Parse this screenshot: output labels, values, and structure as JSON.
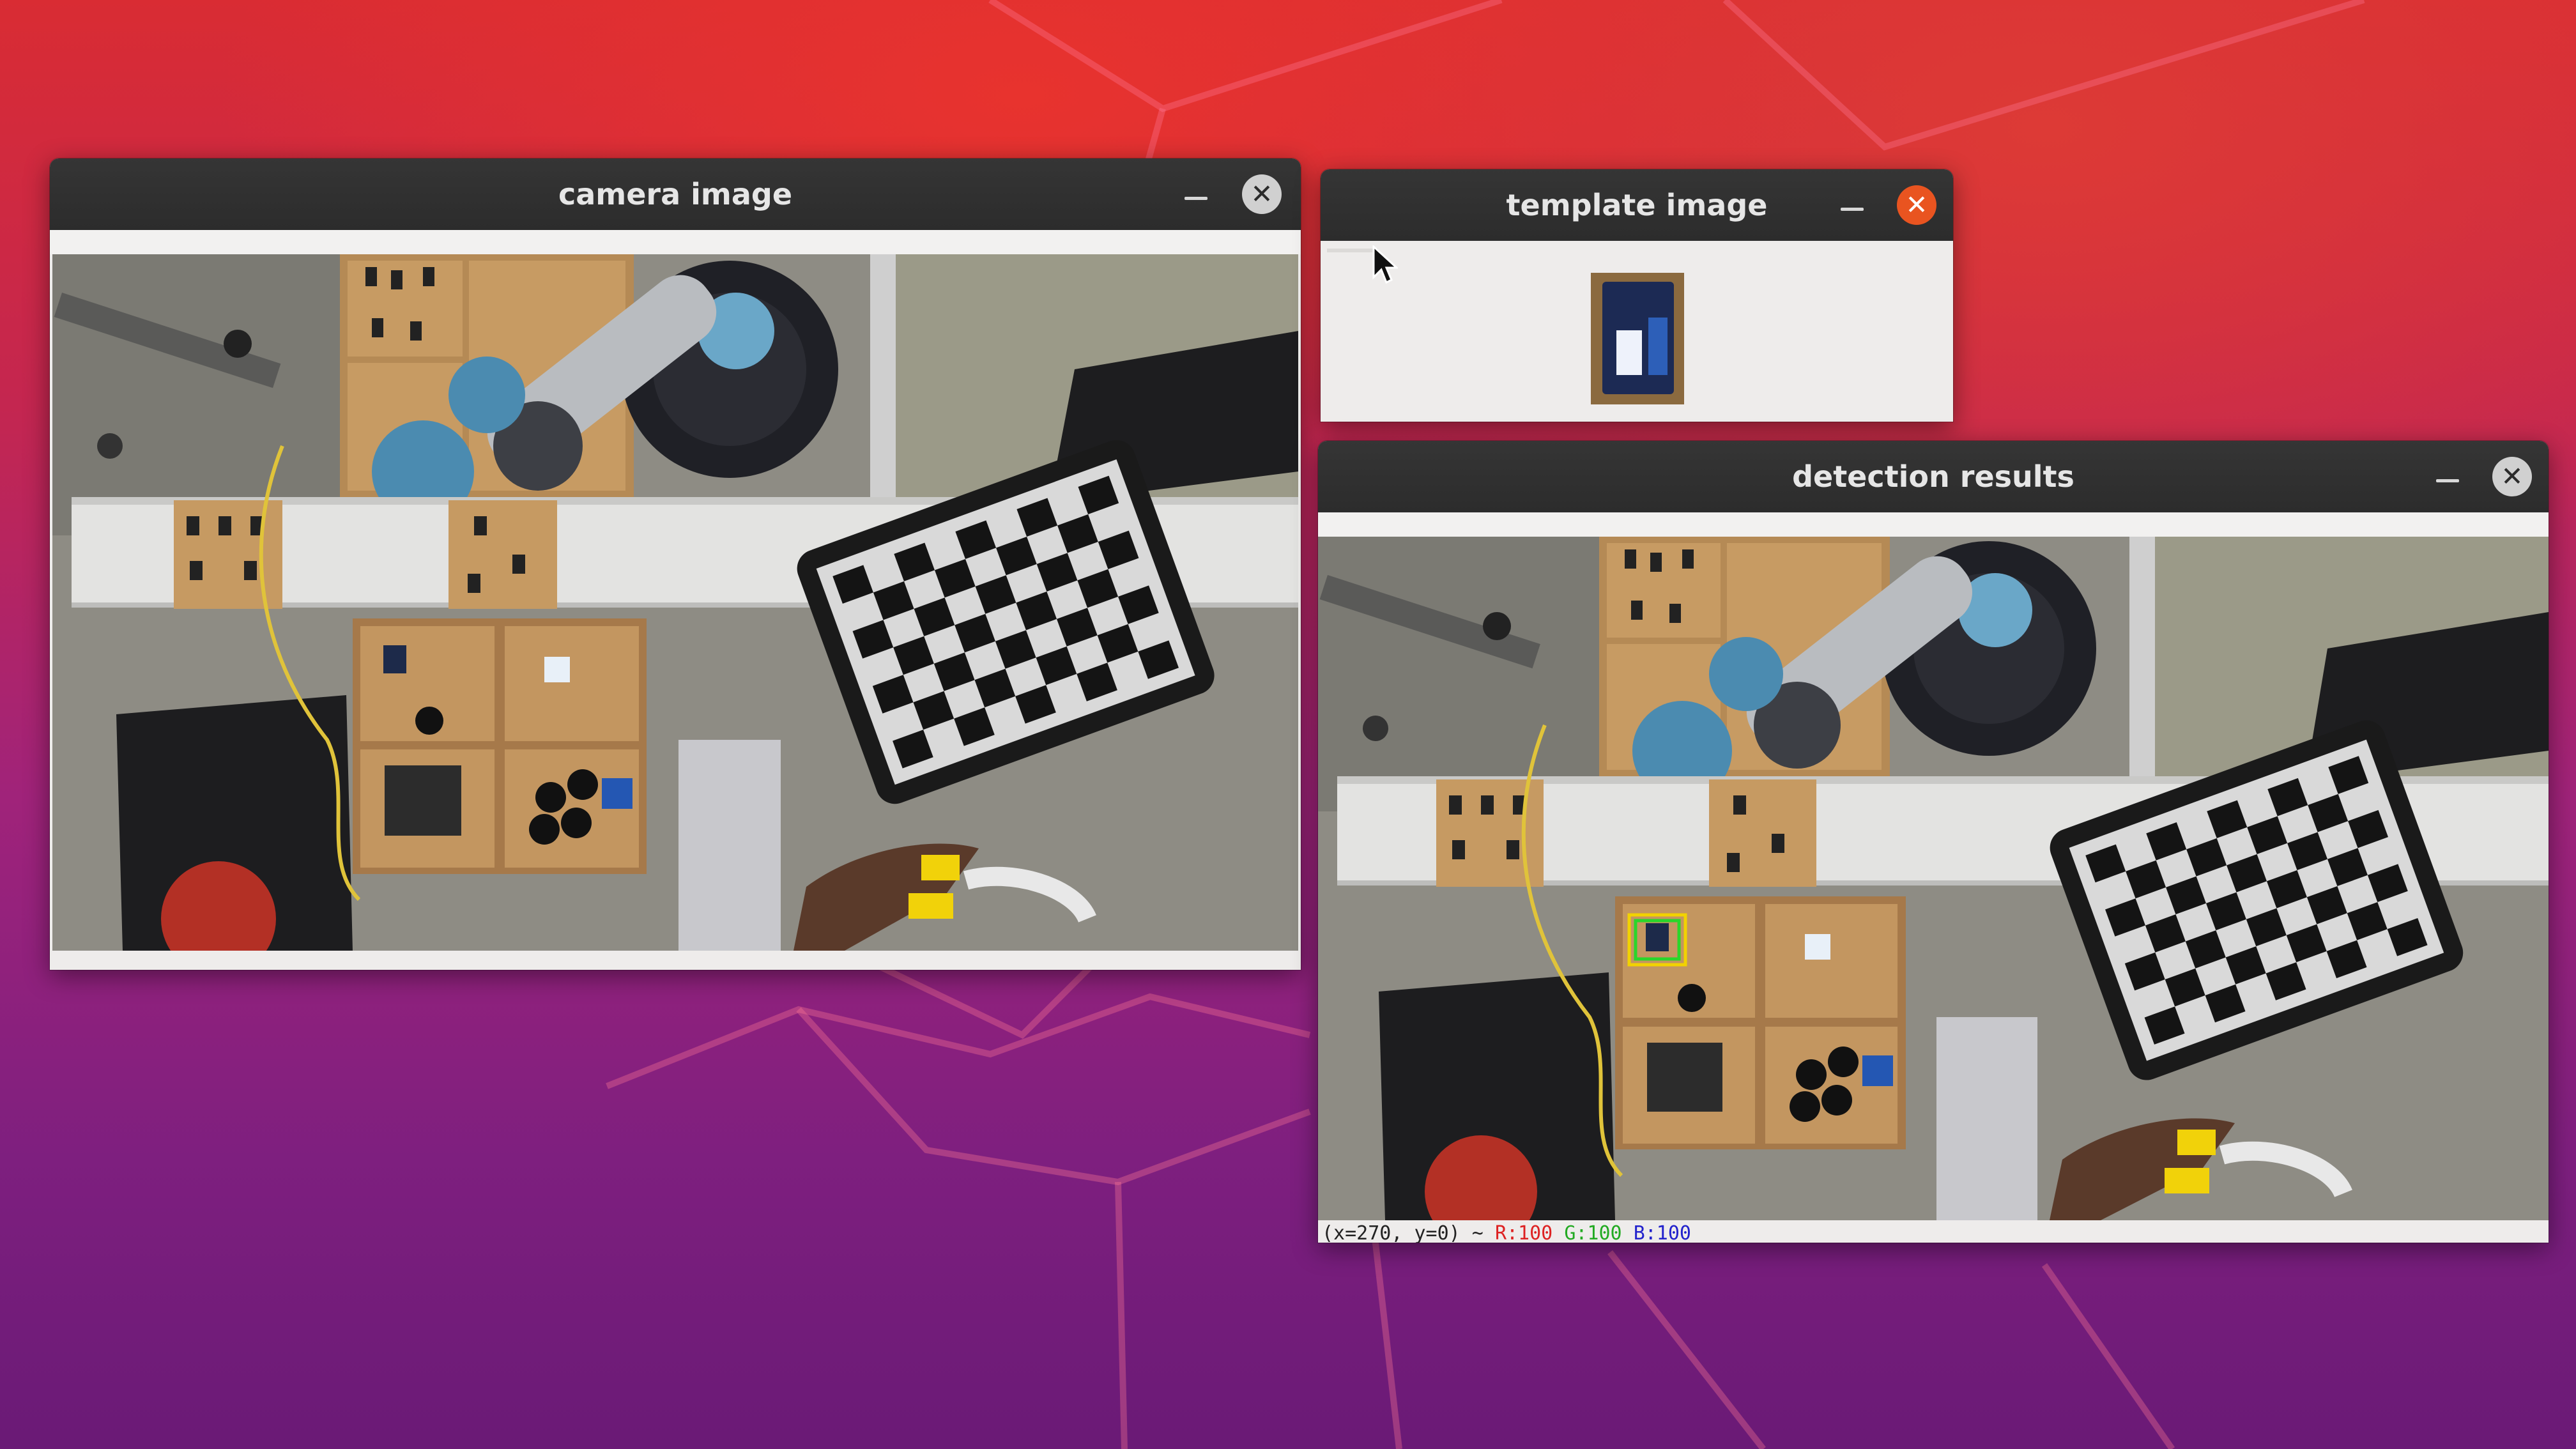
{
  "desktop": {
    "wallpaper": "ubuntu-gradient"
  },
  "windows": {
    "camera": {
      "title": "camera image",
      "close_glyph": "✕"
    },
    "template": {
      "title": "template image",
      "close_glyph": "✕"
    },
    "detection": {
      "title": "detection results",
      "close_glyph": "✕",
      "status": {
        "coords": "(x=270, y=0) ~ ",
        "r": "R:100",
        "g": "G:100",
        "b": "B:100"
      }
    }
  },
  "icons": [
    "minimize-icon",
    "close-icon",
    "mouse-pointer-icon"
  ],
  "colors": {
    "titlebar": "#2c2c2c",
    "close_active": "#e95420",
    "detection_box_outer": "#f2d200",
    "detection_box_inner": "#2ad62a"
  }
}
